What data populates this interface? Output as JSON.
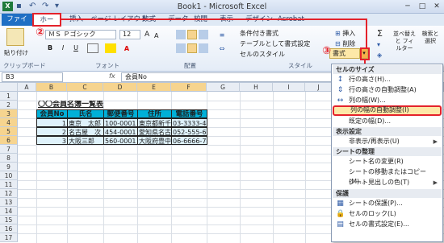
{
  "window": {
    "title": "Book1 - Microsoft Excel",
    "controls": [
      "─",
      "□",
      "✕"
    ]
  },
  "tabs": [
    {
      "label": "ファイル"
    },
    {
      "label": "ホーム"
    },
    {
      "label": "挿入"
    },
    {
      "label": "ページ レイアウト"
    },
    {
      "label": "数式"
    },
    {
      "label": "データ"
    },
    {
      "label": "校閲"
    },
    {
      "label": "表示"
    },
    {
      "label": "デザイン"
    },
    {
      "label": "Acrobat"
    }
  ],
  "ribbon": {
    "paste_label": "貼り付け",
    "clipboard_group": "クリップボード",
    "font_name": "ＭＳ Ｐゴシック",
    "font_size": "12",
    "bold": "B",
    "italic": "I",
    "underline": "U",
    "font_group": "フォント",
    "align_group": "配置",
    "conditional_format": "条件付き書式",
    "format_as_table": "テーブルとして書式設定",
    "cell_styles": "セルのスタイル",
    "style_group": "スタイル",
    "insert": "挿入",
    "delete": "削除",
    "format": "書式",
    "sigma": "Σ",
    "sort_filter": "並べ替えと フィルター",
    "find_select": "検索と 選択"
  },
  "formula_bar": {
    "name_box": "B3",
    "fx": "fx",
    "content": "会員No"
  },
  "columns": [
    "A",
    "B",
    "C",
    "D",
    "E",
    "F",
    "G",
    "H",
    "I",
    "J",
    "K",
    "L",
    "M",
    "N"
  ],
  "rows": [
    "1",
    "2",
    "3",
    "4",
    "5",
    "6",
    "7",
    "8",
    "9",
    "10",
    "11",
    "12",
    "13",
    "14",
    "15",
    "16",
    "17"
  ],
  "sheet": {
    "title": "〇〇会員名簿一覧表",
    "headers": [
      "会員No",
      "氏名",
      "郵便番号",
      "住所",
      "電話番号"
    ],
    "records": [
      [
        "1",
        "東京　太郎",
        "100-0001",
        "東京都新千代",
        "03-3333-4444"
      ],
      [
        "2",
        "名古屋　次",
        "454-0001",
        "愛知県名古",
        "052-555-6666"
      ],
      [
        "3",
        "大阪三郎",
        "560-0001",
        "大阪府豊中",
        "06-6666-7777"
      ]
    ]
  },
  "menu": {
    "sections": [
      "セルのサイズ",
      "表示設定",
      "シートの整理",
      "保護"
    ],
    "items": {
      "row_height": "行の高さ(H)...",
      "autofit_row": "行の高さの自動調整(A)",
      "col_width": "列の幅(W)...",
      "autofit_col": "列の幅の自動調整(I)",
      "default_width": "既定の幅(D)...",
      "hide_unhide": "非表示/再表示(U)",
      "rename_sheet": "シート名の変更(R)",
      "move_copy": "シートの移動またはコピー(M)...",
      "tab_color": "シート見出しの色(T)",
      "protect_sheet": "シートの保護(P)...",
      "lock_cell": "セルのロック(L)",
      "format_cells": "セルの書式設定(E)..."
    }
  },
  "annotations": {
    "step2": "②",
    "step3": "③"
  }
}
